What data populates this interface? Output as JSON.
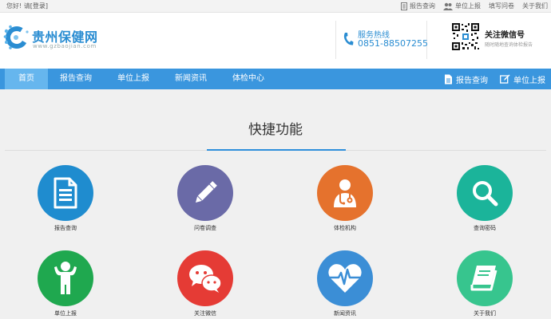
{
  "topbar": {
    "greeting": "您好! 请",
    "login": "[登录]",
    "links": [
      {
        "label": "报告查询",
        "icon": "document-icon"
      },
      {
        "label": "单位上报",
        "icon": "users-icon"
      },
      {
        "label": "填写问卷",
        "icon": ""
      },
      {
        "label": "关于我们",
        "icon": ""
      }
    ]
  },
  "header": {
    "site_name": "贵州保健网",
    "site_url": "www.gzbaojian.com",
    "hotline_label": "服务热线",
    "hotline_number": "0851-88507255",
    "wechat_title": "关注微信号",
    "wechat_sub": "随时随地查询体检报告"
  },
  "nav": {
    "items": [
      "首页",
      "报告查询",
      "单位上报",
      "新闻资讯",
      "体检中心"
    ],
    "active": "首页",
    "right_items": [
      {
        "label": "报告查询",
        "icon": "document-icon"
      },
      {
        "label": "单位上报",
        "icon": "edit-icon"
      }
    ]
  },
  "main": {
    "title": "快捷功能",
    "tiles": [
      {
        "label": "报告查询",
        "icon": "report-document-icon",
        "color": "#1f8ccf"
      },
      {
        "label": "问卷调查",
        "icon": "pencil-icon",
        "color": "#6a6aa7"
      },
      {
        "label": "体检机构",
        "icon": "doctor-icon",
        "color": "#e5722d"
      },
      {
        "label": "查询密码",
        "icon": "magnifier-icon",
        "color": "#1bb49a"
      },
      {
        "label": "单位上报",
        "icon": "person-icon",
        "color": "#1fa84f"
      },
      {
        "label": "关注微信",
        "icon": "wechat-icon",
        "color": "#e53b35"
      },
      {
        "label": "新闻资讯",
        "icon": "heartbeat-icon",
        "color": "#3b8ed6"
      },
      {
        "label": "关于我们",
        "icon": "book-icon",
        "color": "#37c58e"
      }
    ]
  },
  "colors": {
    "nav_bg": "#3a96de",
    "nav_active": "#66b6ee",
    "brand_blue": "#2a8dd2"
  }
}
